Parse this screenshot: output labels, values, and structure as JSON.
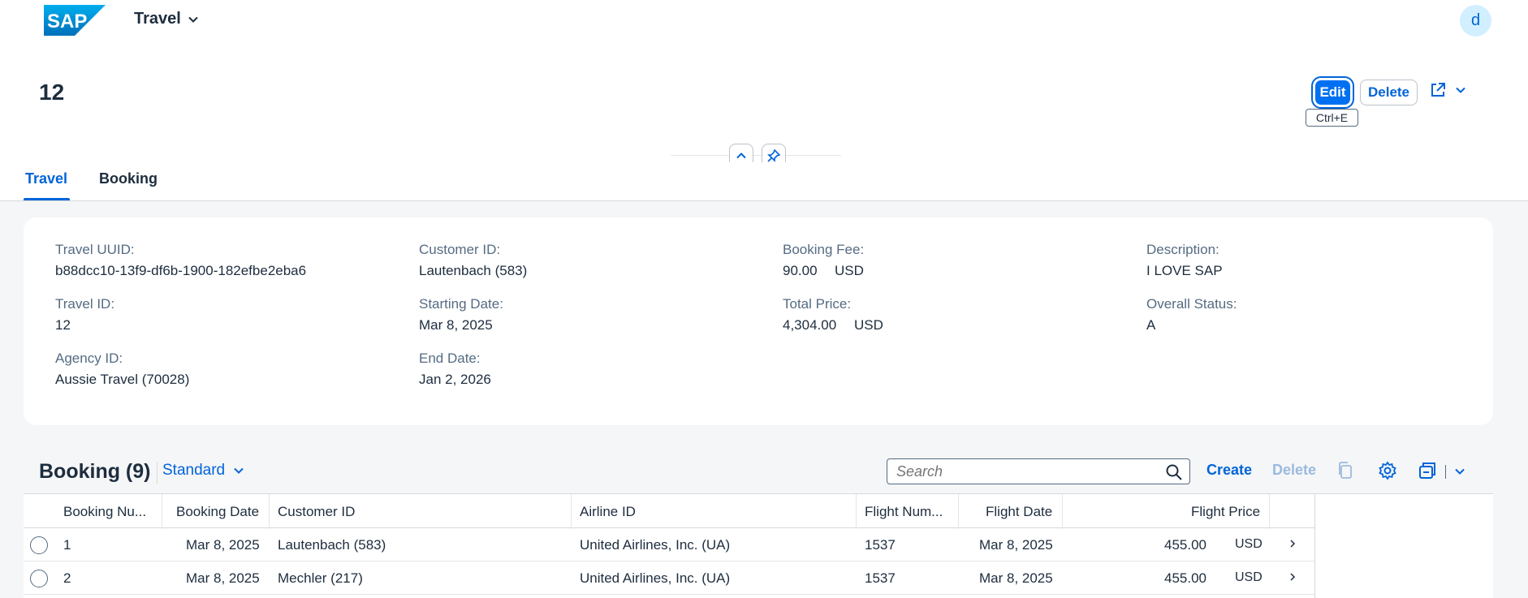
{
  "shell": {
    "logo_text": "SAP",
    "app_title": "Travel",
    "avatar_initial": "d"
  },
  "header": {
    "object_title": "12",
    "edit_label": "Edit",
    "delete_label": "Delete",
    "edit_tooltip": "Ctrl+E"
  },
  "tabs": [
    {
      "label": "Travel",
      "selected": true
    },
    {
      "label": "Booking",
      "selected": false
    }
  ],
  "fields": {
    "travel_uuid": {
      "label": "Travel UUID:",
      "value": "b88dcc10-13f9-df6b-1900-182efbe2eba6"
    },
    "travel_id": {
      "label": "Travel ID:",
      "value": "12"
    },
    "agency_id": {
      "label": "Agency ID:",
      "value": "Aussie Travel (70028)"
    },
    "customer_id": {
      "label": "Customer ID:",
      "value": "Lautenbach (583)"
    },
    "starting_date": {
      "label": "Starting Date:",
      "value": "Mar 8, 2025"
    },
    "end_date": {
      "label": "End Date:",
      "value": "Jan 2, 2026"
    },
    "booking_fee": {
      "label": "Booking Fee:",
      "value": "90.00",
      "currency": "USD"
    },
    "total_price": {
      "label": "Total Price:",
      "value": "4,304.00",
      "currency": "USD"
    },
    "description": {
      "label": "Description:",
      "value": "I LOVE SAP"
    },
    "overall_status": {
      "label": "Overall Status:",
      "value": "A"
    }
  },
  "booking_section": {
    "title": "Booking (9)",
    "variant": "Standard",
    "search_placeholder": "Search",
    "create_label": "Create",
    "delete_label": "Delete"
  },
  "table": {
    "columns": [
      "Booking Nu...",
      "Booking Date",
      "Customer ID",
      "Airline ID",
      "Flight Num...",
      "Flight Date",
      "Flight Price"
    ],
    "rows": [
      {
        "booking_num": "1",
        "booking_date": "Mar 8, 2025",
        "customer": "Lautenbach (583)",
        "airline": "United Airlines, Inc. (UA)",
        "flight_num": "1537",
        "flight_date": "Mar 8, 2025",
        "price": "455.00",
        "currency": "USD"
      },
      {
        "booking_num": "2",
        "booking_date": "Mar 8, 2025",
        "customer": "Mechler (217)",
        "airline": "United Airlines, Inc. (UA)",
        "flight_num": "1537",
        "flight_date": "Mar 8, 2025",
        "price": "455.00",
        "currency": "USD"
      }
    ]
  },
  "colors": {
    "brand_blue": "#0070f2",
    "link_blue": "#0064d9",
    "text": "#1d2d3e",
    "label_gray": "#556b82",
    "page_bg": "#f5f6f7"
  }
}
